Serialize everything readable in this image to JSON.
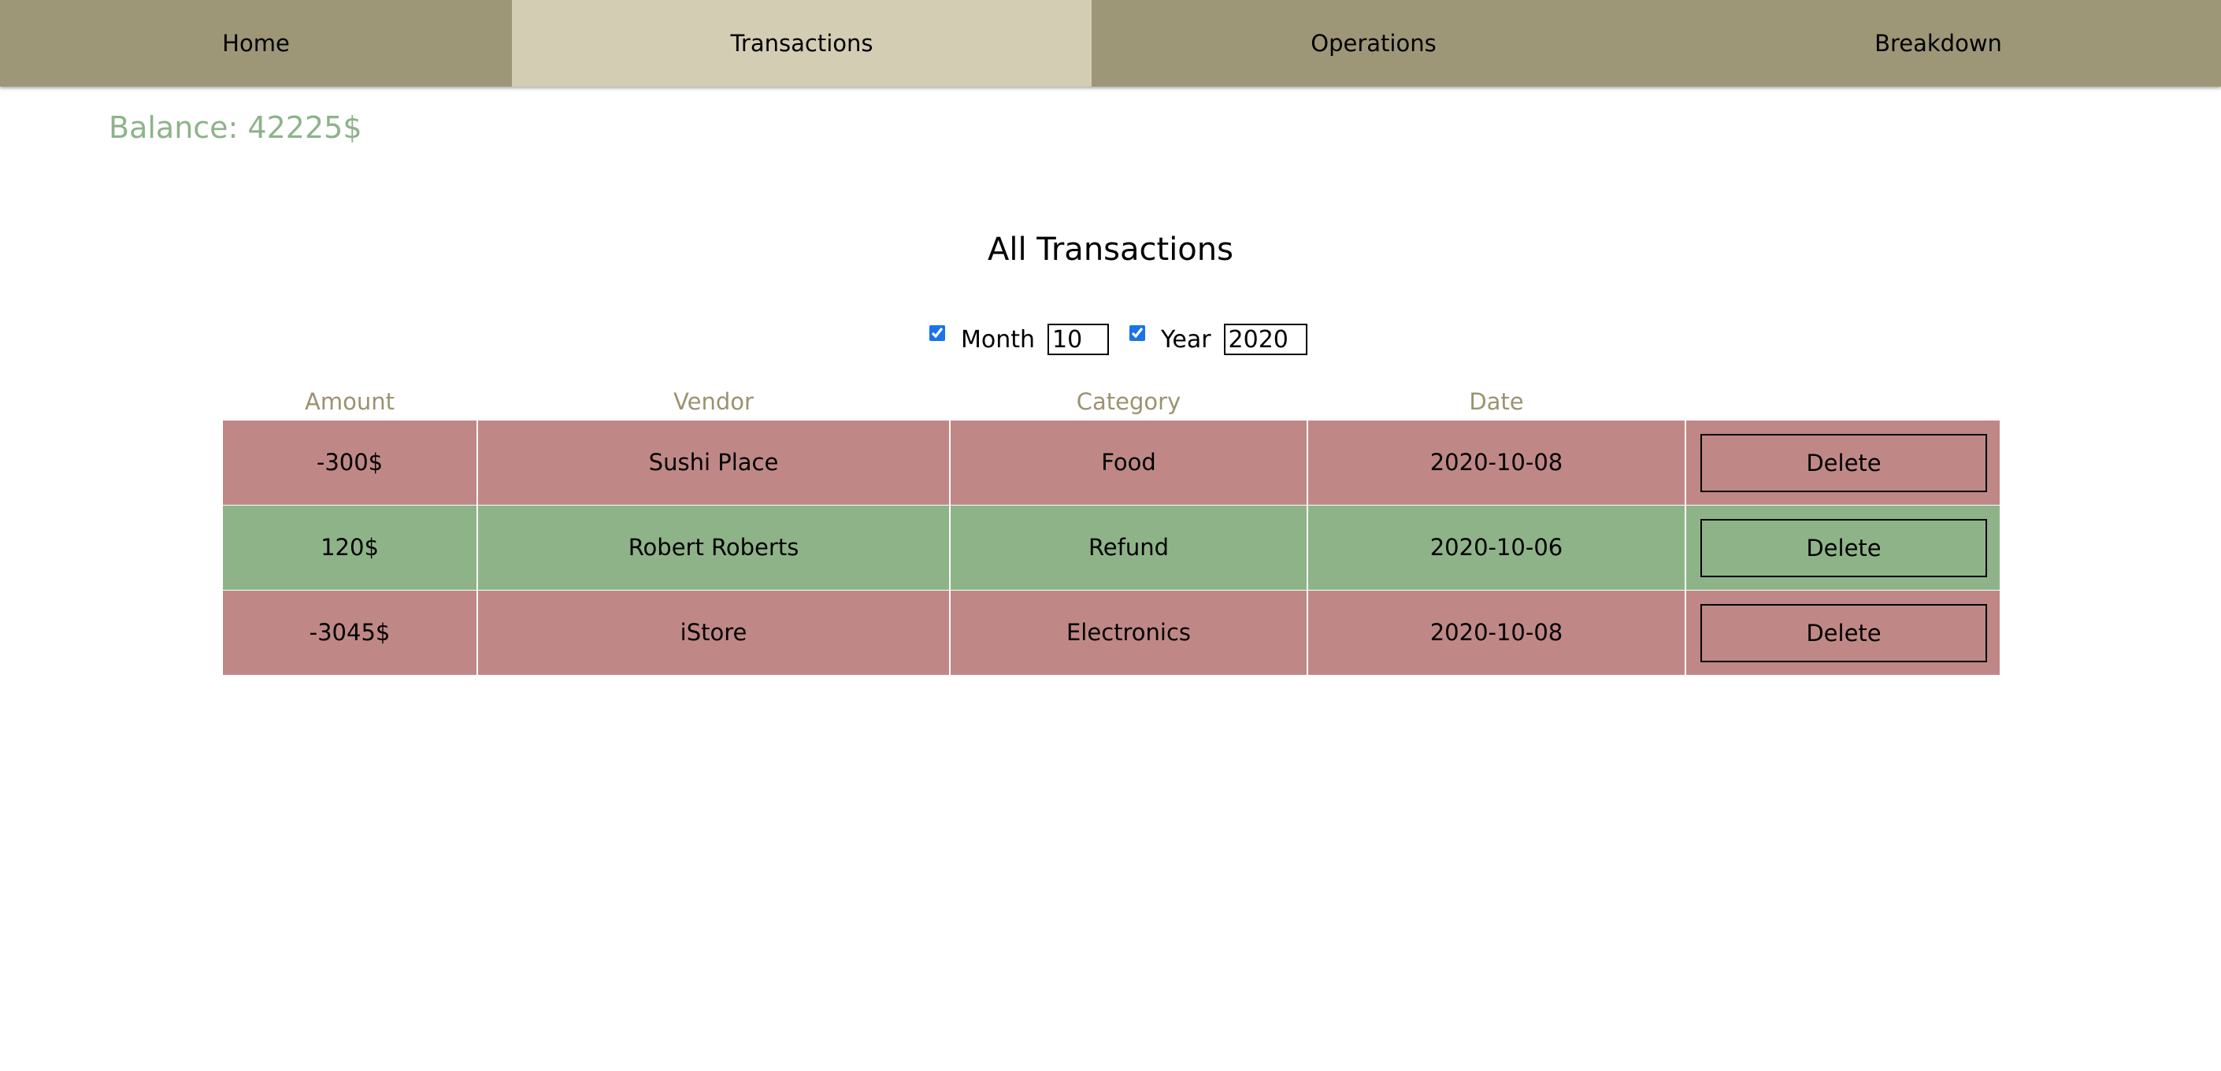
{
  "nav": {
    "tabs": [
      {
        "label": "Home"
      },
      {
        "label": "Transactions"
      },
      {
        "label": "Operations"
      },
      {
        "label": "Breakdown"
      }
    ],
    "active": "Transactions"
  },
  "balance": "Balance: 42225$",
  "page_title": "All Transactions",
  "filters": {
    "month_label": "Month",
    "month_checked": true,
    "month_value": "10",
    "year_label": "Year",
    "year_checked": true,
    "year_value": "2020"
  },
  "table": {
    "headers": [
      "Amount",
      "Vendor",
      "Category",
      "Date"
    ],
    "rows": [
      {
        "amount": "-300$",
        "vendor": "Sushi Place",
        "category": "Food",
        "date": "2020-10-08",
        "action": "Delete",
        "kind": "expense"
      },
      {
        "amount": "120$",
        "vendor": "Robert Roberts",
        "category": "Refund",
        "date": "2020-10-06",
        "action": "Delete",
        "kind": "income"
      },
      {
        "amount": "-3045$",
        "vendor": "iStore",
        "category": "Electronics",
        "date": "2020-10-08",
        "action": "Delete",
        "kind": "expense"
      }
    ]
  },
  "colors": {
    "nav_bg": "#9d9778",
    "nav_active": "#d3cdb4",
    "expense_row": "#bf8886",
    "income_row": "#8fb388",
    "balance_text": "#8db38a",
    "header_text": "#9b9270"
  }
}
